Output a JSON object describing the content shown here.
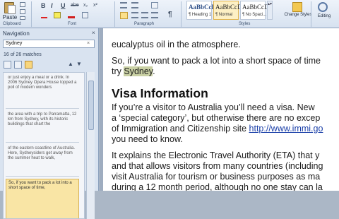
{
  "ribbon": {
    "paste_label": "Paste",
    "clipboard_label": "Clipboard",
    "font_label": "Font",
    "paragraph_label": "Paragraph",
    "styles_label": "Styles",
    "bold": "B",
    "italic": "I",
    "underline": "U",
    "strike": "abe",
    "subscript": "x₂",
    "superscript": "x²",
    "pilcrow": "¶",
    "styles": [
      {
        "sample": "AaBbCcDc",
        "name": "¶ Heading 1"
      },
      {
        "sample": "AaBbCcDc",
        "name": "¶ Normal"
      },
      {
        "sample": "AaBbCcDc",
        "name": "¶ No Spaci..."
      }
    ],
    "change_styles_label": "Change Styles",
    "editing_label": "Editing"
  },
  "nav": {
    "title": "Navigation",
    "close": "×",
    "search_value": "Sydney",
    "search_clear": "×",
    "match_count": "16 of 26 matches",
    "results": [
      "or just enjoy a meal or a drink. In 2006 Sydney Opera House topped a poll of modern wonders",
      "the area with a trip to Parramatta, 12 km from Sydney, with its historic buildings that chart the",
      "of the eastern coastline of Australia. Here, Sydneysiders get away from the summer heat to walk,",
      "So, if you want to pack a lot into a short space of time,"
    ]
  },
  "doc": {
    "line1": "eucalyptus oil in the atmosphere.",
    "line2": "So, if you want to pack a lot into a short space of time",
    "line3_pre": "try ",
    "line3_hl": "Sydney",
    "line3_post": ".",
    "heading": "Visa Information",
    "p2_l1": "If you’re a visitor to Australia you’ll need a visa.  New",
    "p2_l2": "a ‘special category’, but otherwise there are no excep",
    "p2_l3_pre": "of Immigration and Citizenship site ",
    "p2_l3_link": "http://www.immi.go",
    "p2_l4": "you need to know.",
    "p3_l1": "It explains the Electronic Travel Authority (ETA) that y",
    "p3_l2": "and that allows visitors from many countries (including",
    "p3_l3": "visit Australia for tourism or business purposes as ma",
    "p3_l4": "during a 12 month period, although no one stay can la"
  }
}
